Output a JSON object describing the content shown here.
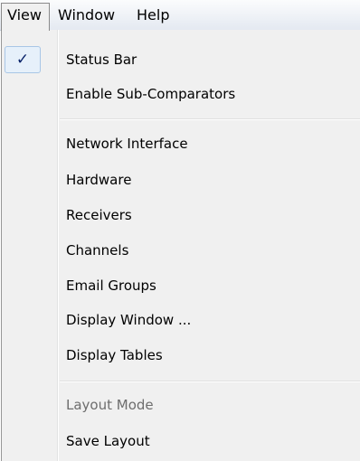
{
  "menubar": {
    "items": [
      {
        "label": "View"
      },
      {
        "label": "Window"
      },
      {
        "label": "Help"
      }
    ]
  },
  "dropdown": {
    "check_mark": "✓",
    "items": [
      {
        "label": "Status Bar",
        "checked": true
      },
      {
        "label": "Enable Sub-Comparators"
      },
      {
        "label": "Network Interface"
      },
      {
        "label": "Hardware"
      },
      {
        "label": "Receivers"
      },
      {
        "label": "Channels"
      },
      {
        "label": "Email Groups"
      },
      {
        "label": "Display Window ..."
      },
      {
        "label": "Display Tables"
      },
      {
        "label": "Layout Mode",
        "disabled": true
      },
      {
        "label": "Save Layout"
      }
    ]
  }
}
